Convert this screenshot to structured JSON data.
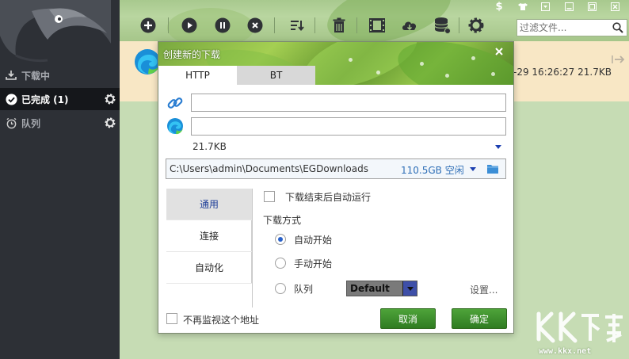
{
  "sidebar": {
    "items": [
      {
        "label": "下载中",
        "icon": "download-tray-icon"
      },
      {
        "label": "已完成 (1)",
        "icon": "check-circle-icon"
      },
      {
        "label": "队列",
        "icon": "alarm-clock-icon"
      }
    ]
  },
  "toolbar": {
    "buttons": [
      "add-icon",
      "play-icon",
      "pause-icon",
      "stop-icon",
      "sort-icon",
      "trash-icon",
      "video-icon",
      "cloud-download-icon",
      "database-icon",
      "gear-icon"
    ],
    "filter_placeholder": "过滤文件..."
  },
  "download_row": {
    "meta": "-29 16:26:27   21.7KB"
  },
  "dialog": {
    "title": "创建新的下载",
    "tabs": [
      "HTTP",
      "BT"
    ],
    "url_value": "",
    "file_name_value": "",
    "file_size": "21.7KB",
    "save_path": "C:\\Users\\admin\\Documents\\EGDownloads",
    "free_space": "110.5GB 空闲",
    "side_tabs": [
      "通用",
      "连接",
      "自动化"
    ],
    "auto_run_label": "下载结束后自动运行",
    "mode_heading": "下载方式",
    "mode_auto": "自动开始",
    "mode_manual": "手动开始",
    "mode_queue": "队列",
    "queue_value": "Default",
    "settings_link": "设置...",
    "no_monitor_label": "不再监视这个地址",
    "cancel_label": "取消",
    "ok_label": "确定"
  },
  "watermark": {
    "url": "www.kkx.net"
  },
  "colors": {
    "sidebar_bg": "#2d3036",
    "sidebar_active": "#15171b",
    "content_bg": "#c6dcb4",
    "row_bg": "#f8e7c5",
    "button_green": "#2f7c21",
    "free_space_blue": "#2f6fb7",
    "selected_tab_text": "#1f3f99"
  }
}
